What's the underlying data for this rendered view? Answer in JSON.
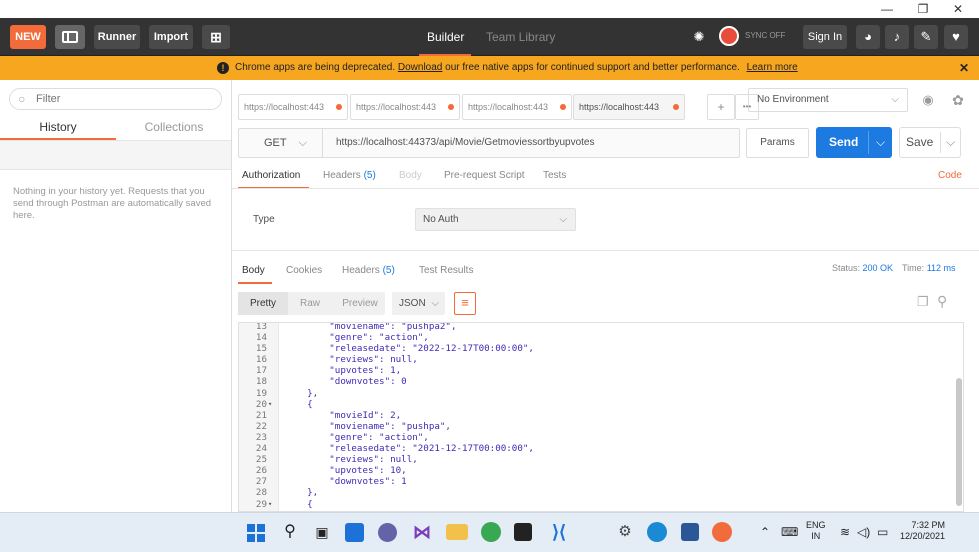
{
  "window": {
    "minimize": "—",
    "maximize": "❐",
    "close": "✕"
  },
  "toolbar": {
    "new": "NEW",
    "runner": "Runner",
    "import": "Import",
    "builder": "Builder",
    "team_library": "Team Library",
    "sync": "SYNC OFF",
    "sign_in": "Sign In"
  },
  "banner": {
    "text_before": "Chrome apps are being deprecated. ",
    "download": "Download",
    "text_after": " our free native apps for continued support and better performance.",
    "learn_more": "Learn more",
    "close": "✕"
  },
  "sidebar": {
    "filter_placeholder": "Filter",
    "tab_history": "History",
    "tab_collections": "Collections",
    "empty_text": "Nothing in your history yet. Requests that you send through Postman are automatically saved here."
  },
  "request_tabs": [
    {
      "label": "https://localhost:443"
    },
    {
      "label": "https://localhost:443"
    },
    {
      "label": "https://localhost:443"
    },
    {
      "label": "https://localhost:443"
    }
  ],
  "tabs_add": "+",
  "tabs_more": "•••",
  "environment": {
    "label": "No Environment"
  },
  "request": {
    "method": "GET",
    "url": "https://localhost:44373/api/Movie/Getmoviessortbyupvotes",
    "params": "Params",
    "send": "Send",
    "save": "Save"
  },
  "req_tabs": {
    "authorization": "Authorization",
    "headers": "Headers",
    "headers_count": "(5)",
    "body": "Body",
    "pre_request": "Pre-request Script",
    "tests": "Tests",
    "code": "Code"
  },
  "auth": {
    "type_label": "Type",
    "type_value": "No Auth"
  },
  "response": {
    "body": "Body",
    "cookies": "Cookies",
    "headers": "Headers",
    "headers_count": "(5)",
    "test_results": "Test Results",
    "status_label": "Status:",
    "status_value": "200 OK",
    "time_label": "Time:",
    "time_value": "112 ms"
  },
  "view": {
    "pretty": "Pretty",
    "raw": "Raw",
    "preview": "Preview",
    "format": "JSON"
  },
  "code_lines": [
    {
      "n": "13",
      "fold": "",
      "text": "        \"moviename\": \"pushpa2\","
    },
    {
      "n": "14",
      "fold": "",
      "text": "        \"genre\": \"action\","
    },
    {
      "n": "15",
      "fold": "",
      "text": "        \"releasedate\": \"2022-12-17T00:00:00\","
    },
    {
      "n": "16",
      "fold": "",
      "text": "        \"reviews\": null,"
    },
    {
      "n": "17",
      "fold": "",
      "text": "        \"upvotes\": 1,"
    },
    {
      "n": "18",
      "fold": "",
      "text": "        \"downvotes\": 0"
    },
    {
      "n": "19",
      "fold": "",
      "text": "    },"
    },
    {
      "n": "20",
      "fold": "▾",
      "text": "    {"
    },
    {
      "n": "21",
      "fold": "",
      "text": "        \"movieId\": 2,"
    },
    {
      "n": "22",
      "fold": "",
      "text": "        \"moviename\": \"pushpa\","
    },
    {
      "n": "23",
      "fold": "",
      "text": "        \"genre\": \"action\","
    },
    {
      "n": "24",
      "fold": "",
      "text": "        \"releasedate\": \"2021-12-17T00:00:00\","
    },
    {
      "n": "25",
      "fold": "",
      "text": "        \"reviews\": null,"
    },
    {
      "n": "26",
      "fold": "",
      "text": "        \"upvotes\": 10,"
    },
    {
      "n": "27",
      "fold": "",
      "text": "        \"downvotes\": 1"
    },
    {
      "n": "28",
      "fold": "",
      "text": "    },"
    },
    {
      "n": "29",
      "fold": "▾",
      "text": "    {"
    }
  ],
  "taskbar": {
    "lang1": "ENG",
    "lang2": "IN",
    "time": "7:32 PM",
    "date": "12/20/2021"
  },
  "colors": {
    "accent": "#f26b3a",
    "send": "#1c7ae0",
    "banner": "#f6a61f",
    "toolbar": "#333333"
  }
}
